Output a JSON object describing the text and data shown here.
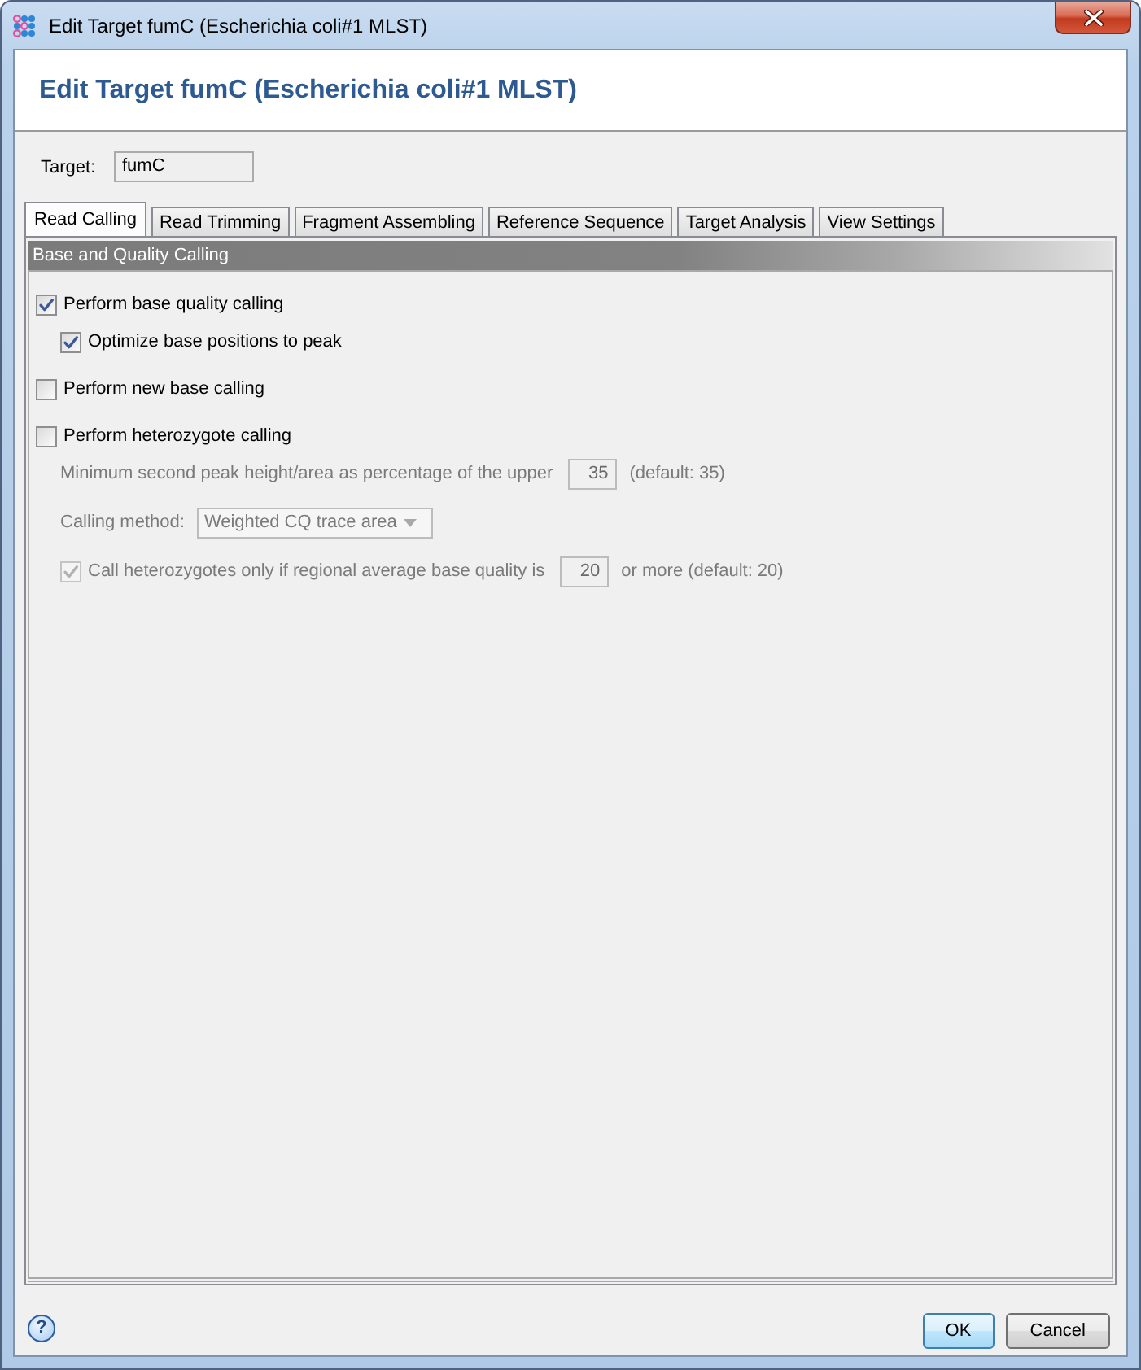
{
  "window": {
    "title": "Edit Target fumC (Escherichia coli#1 MLST)"
  },
  "header": {
    "title": "Edit Target fumC (Escherichia coli#1 MLST)"
  },
  "target": {
    "label": "Target:",
    "value": "fumC"
  },
  "tabs": [
    {
      "label": "Read Calling",
      "selected": true
    },
    {
      "label": "Read Trimming",
      "selected": false
    },
    {
      "label": "Fragment Assembling",
      "selected": false
    },
    {
      "label": "Reference Sequence",
      "selected": false
    },
    {
      "label": "Target Analysis",
      "selected": false
    },
    {
      "label": "View Settings",
      "selected": false
    }
  ],
  "section": {
    "title": "Base and Quality Calling"
  },
  "options": [
    {
      "kind": "checkbox",
      "label": "Perform base quality calling",
      "checked": true,
      "disabled": false,
      "children": [
        {
          "kind": "checkbox",
          "label": "Optimize base positions to peak",
          "checked": true,
          "disabled": false
        }
      ]
    },
    {
      "kind": "checkbox",
      "label": "Perform new base calling",
      "checked": false,
      "disabled": false
    },
    {
      "kind": "checkbox",
      "label": "Perform heterozygote calling",
      "checked": false,
      "disabled": false,
      "children": [
        {
          "kind": "number",
          "label": "Minimum second peak height/area as percentage of the upper",
          "value": "35",
          "suffix": "(default: 35)",
          "disabled": true
        },
        {
          "kind": "select",
          "label": "Calling method:",
          "value": "Weighted CQ trace area",
          "disabled": true
        },
        {
          "kind": "checkbox_number",
          "label": "Call heterozygotes only if regional average base quality is",
          "checked": true,
          "value": "20",
          "suffix": "or more (default: 20)",
          "disabled": true
        }
      ]
    }
  ],
  "help": {
    "symbol": "?"
  },
  "buttons": [
    {
      "label": "OK",
      "default": true
    },
    {
      "label": "Cancel",
      "default": false
    }
  ]
}
